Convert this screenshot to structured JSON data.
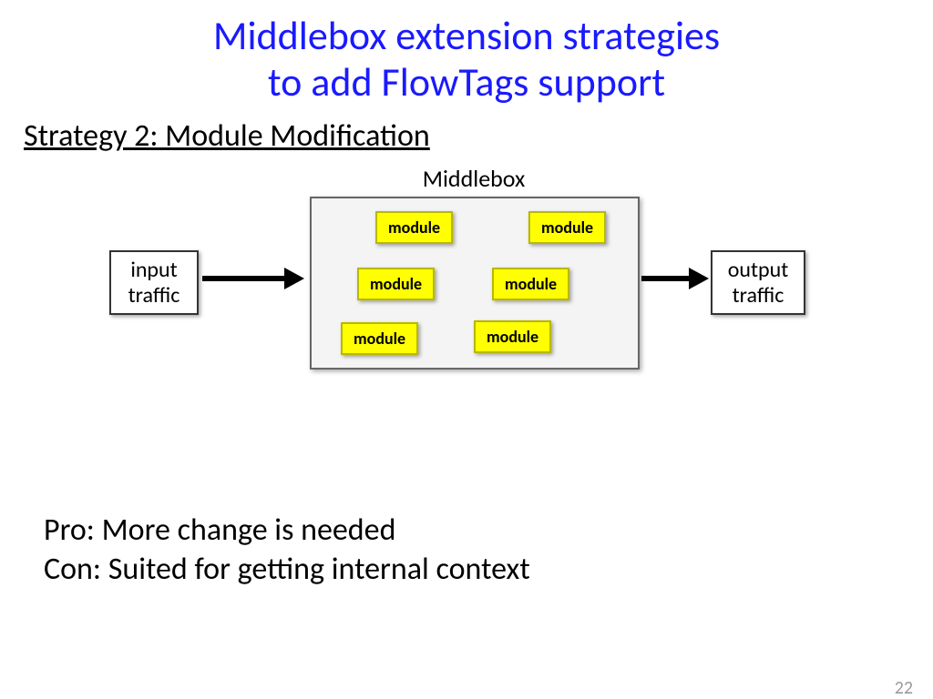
{
  "title_line1": "Middlebox extension strategies",
  "title_line2": "to add FlowTags support",
  "subtitle": "Strategy 2: Module Modification",
  "diagram": {
    "input_label": "input\ntraffic",
    "output_label": "output\ntraffic",
    "middlebox_label": "Middlebox",
    "module_label": "module"
  },
  "notes": {
    "pro": "Pro: More change is needed",
    "con": "Con: Suited for getting internal context"
  },
  "page_number": "22"
}
